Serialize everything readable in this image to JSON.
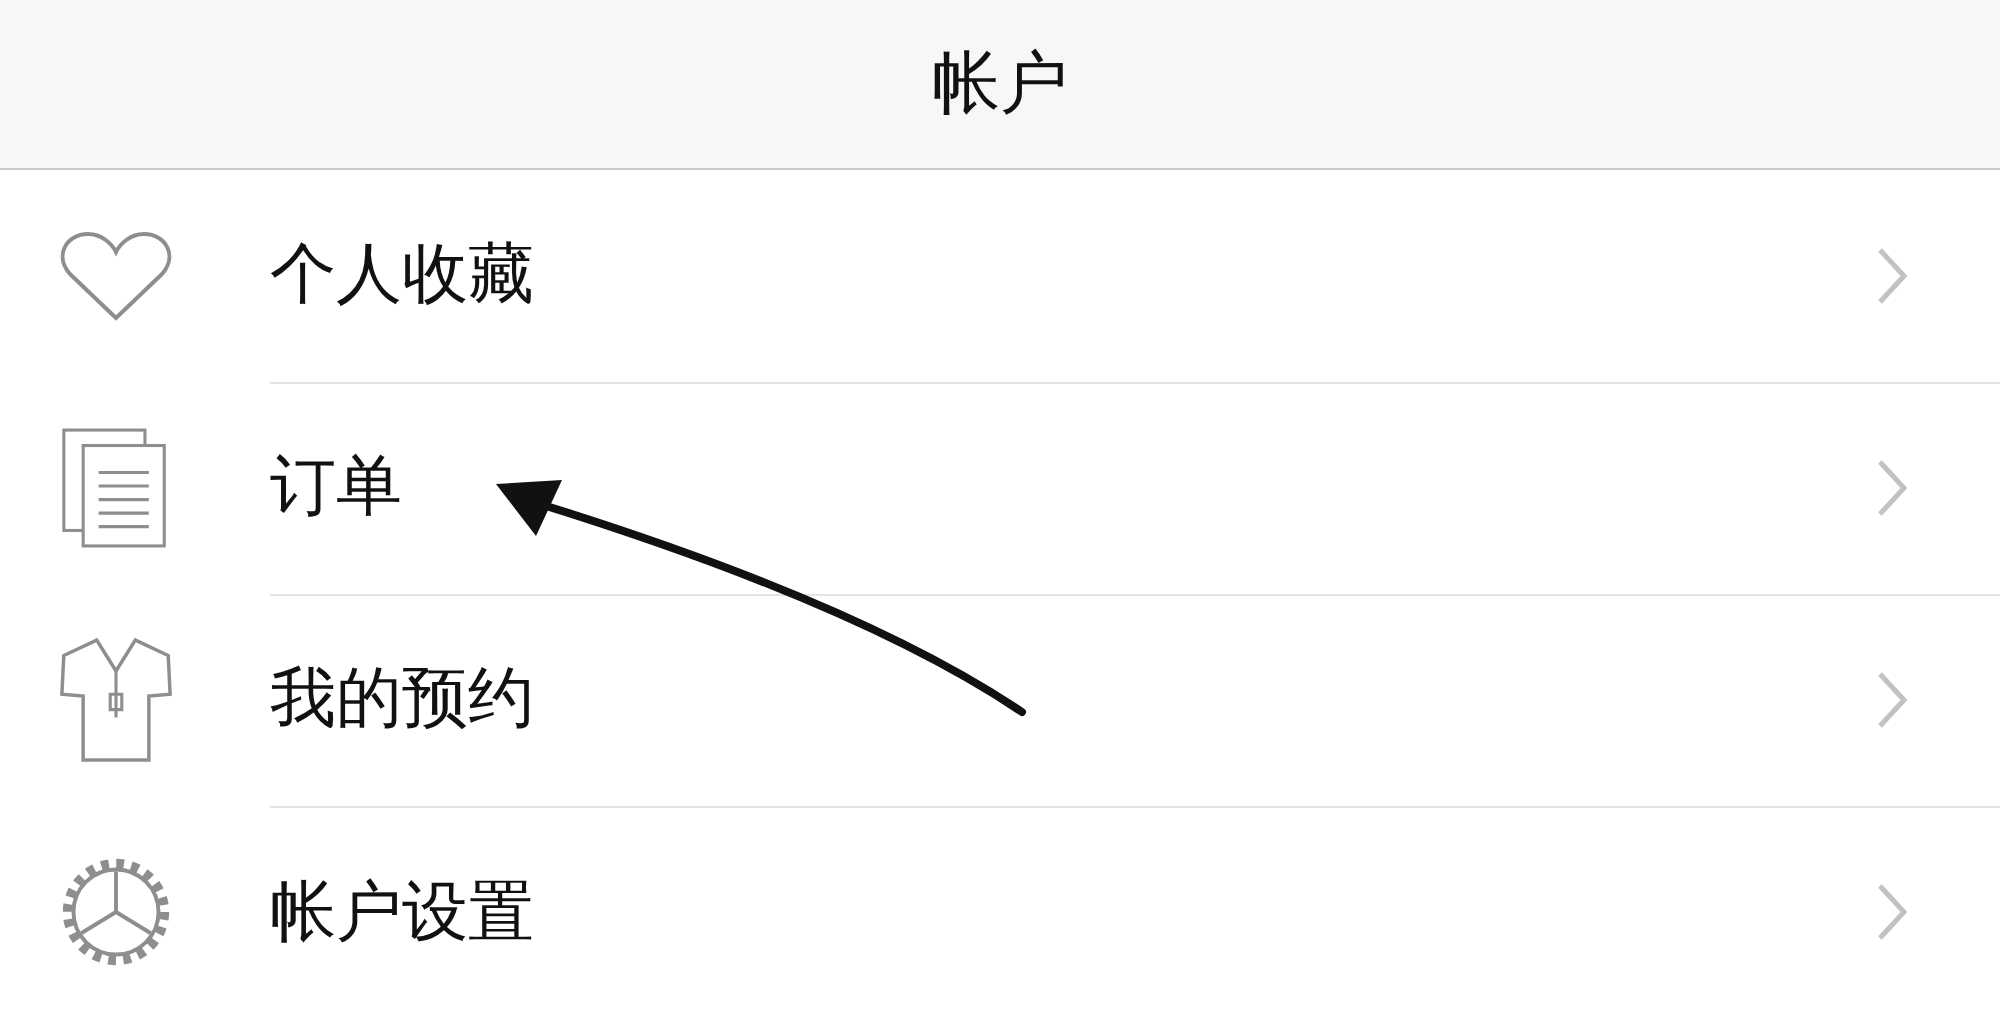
{
  "header": {
    "title": "帐户"
  },
  "items": [
    {
      "label": "个人收藏"
    },
    {
      "label": "订单"
    },
    {
      "label": "我的预约"
    },
    {
      "label": "帐户设置"
    }
  ]
}
